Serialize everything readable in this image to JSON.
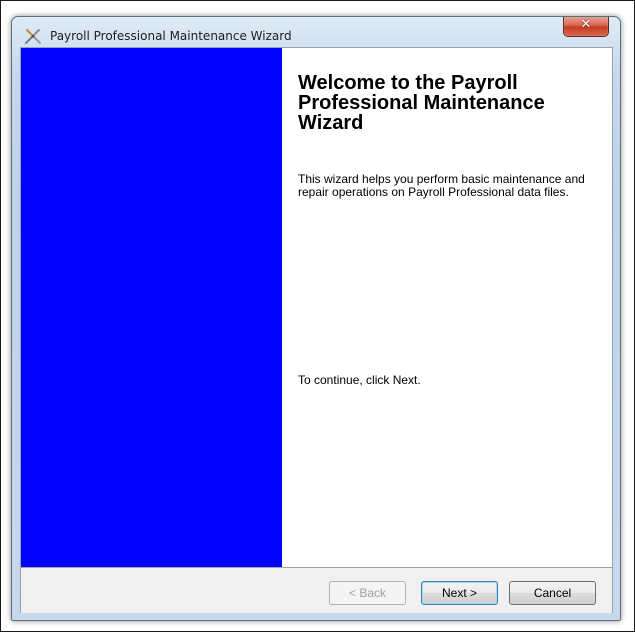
{
  "window": {
    "title": "Payroll Professional Maintenance Wizard",
    "close_glyph": "✕",
    "app_icon": "tools-icon"
  },
  "banner": {
    "color": "#0000ff"
  },
  "content": {
    "welcome_title": "Welcome to the Payroll Professional Maintenance Wizard",
    "description": "This wizard helps you perform basic maintenance and repair operations on Payroll Professional data files.",
    "continue_text": "To continue, click Next."
  },
  "buttons": {
    "back_label": "< Back",
    "next_label": "Next >",
    "cancel_label": "Cancel"
  }
}
